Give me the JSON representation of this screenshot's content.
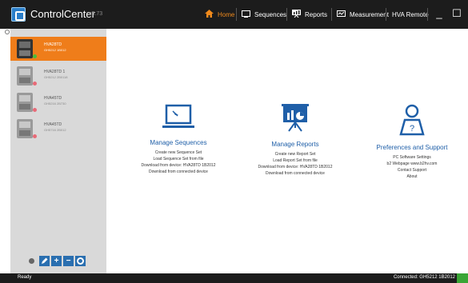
{
  "app": {
    "name": "ControlCenter",
    "version": "v3.73"
  },
  "nav": {
    "home": "Home",
    "sequences": "Sequences",
    "reports": "Reports",
    "measurement": "Measurement",
    "remote": "HVA Remote"
  },
  "window": {
    "minimize": "_",
    "maximize": "☐"
  },
  "devices": [
    {
      "name": "HVA28TD",
      "serial": "GH5212 1B012"
    },
    {
      "name": "HVA28TD 1",
      "serial": "GH5212 2B0118"
    },
    {
      "name": "HVA45TD",
      "serial": "GH5216 2B730"
    },
    {
      "name": "HVA45TD",
      "serial": "GH5716 2B012"
    }
  ],
  "sidebar_toolbar": {
    "add": "+",
    "remove": "−"
  },
  "cards": {
    "sequences": {
      "title": "Manage Sequences",
      "links": [
        "Create new Sequence Set",
        "Load Sequence Set from file",
        "Download from device: HVA28TD 1B2012",
        "Download from connected device"
      ]
    },
    "reports": {
      "title": "Manage Reports",
      "links": [
        "Create new Report Set",
        "Load Report Set from file",
        "Download from device: HVA28TD 1B2012",
        "Download from connected device"
      ]
    },
    "preferences": {
      "title": "Preferences and Support",
      "links": [
        "PC Software Settings",
        "b2 Webpage www.b2hv.com",
        "Contact Support",
        "About"
      ]
    }
  },
  "status": {
    "left": "Ready",
    "right": "Connected: GH5212 1B2012"
  },
  "colors": {
    "accent": "#ef7d1a",
    "brand_blue": "#1f5fa8",
    "titlebar": "#1c1c1c",
    "connected": "#3aa535"
  }
}
